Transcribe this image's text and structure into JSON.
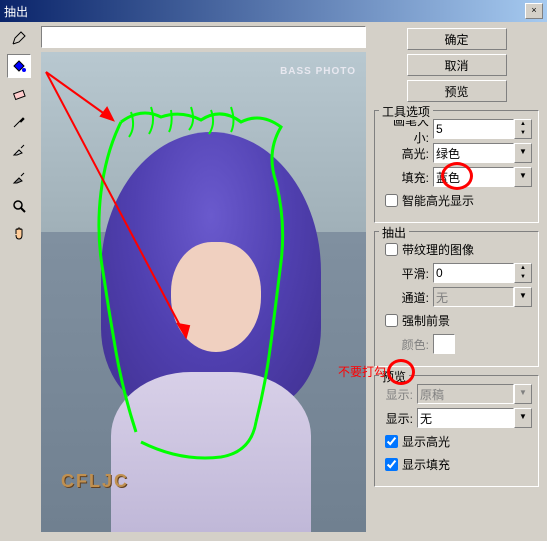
{
  "title": "抽出",
  "buttons": {
    "ok": "确定",
    "cancel": "取消",
    "preview": "预览"
  },
  "toolOptions": {
    "title": "工具选项",
    "brushSize": {
      "label": "画笔大小:",
      "value": "5"
    },
    "highlight": {
      "label": "高光:",
      "value": "绿色"
    },
    "fill": {
      "label": "填充:",
      "value": "蓝色"
    },
    "smartHighlight": "智能高光显示"
  },
  "extract": {
    "title": "抽出",
    "textured": "带纹理的图像",
    "smooth": {
      "label": "平滑:",
      "value": "0"
    },
    "channel": {
      "label": "通道:",
      "value": "无"
    },
    "forceFg": "强制前景",
    "color": "颜色:"
  },
  "preview": {
    "title": "预览",
    "show1": {
      "label": "显示:",
      "value": "原稿"
    },
    "show2": {
      "label": "显示:",
      "value": "无"
    },
    "showHighlight": "显示高光",
    "showFill": "显示填充"
  },
  "watermark": "BASS PHOTO",
  "logo": "CFLJC",
  "note": "不要打勾",
  "icons": {
    "pencil": "✎",
    "bucket": "▲",
    "eraser": "◫",
    "dropper": "✎",
    "clean": "▨",
    "zoom": "🔍",
    "hand": "✋"
  }
}
